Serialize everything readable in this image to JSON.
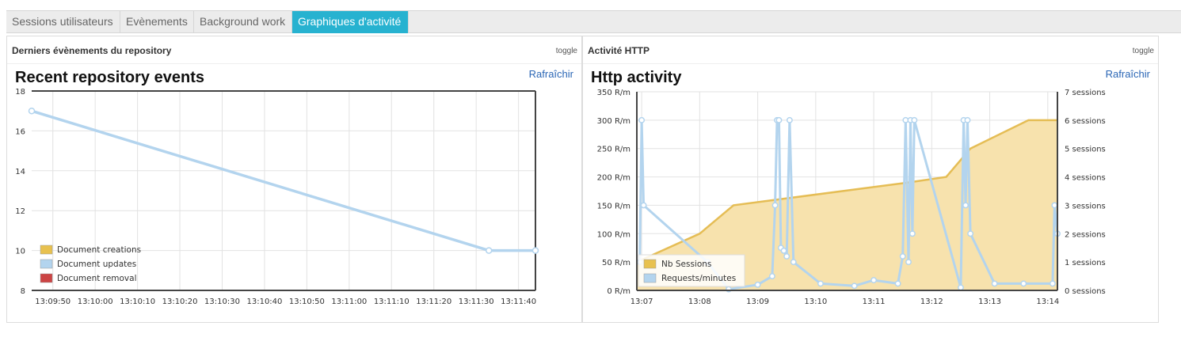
{
  "tabs": [
    {
      "label": "Sessions utilisateurs",
      "active": false
    },
    {
      "label": "Evènements",
      "active": false
    },
    {
      "label": "Background work",
      "active": false
    },
    {
      "label": "Graphiques d'activité",
      "active": true
    }
  ],
  "panels": {
    "left": {
      "title": "Derniers évènements du repository",
      "toggle": "toggle",
      "refresh": "Rafraîchir"
    },
    "right": {
      "title": "Activité HTTP",
      "toggle": "toggle",
      "refresh": "Rafraîchir"
    }
  },
  "colors": {
    "creations": "#e8c14f",
    "updates": "#b3d4ee",
    "removal": "#cc4444",
    "sessions_fill": "#f7e2ad",
    "sessions_line": "#e5bd55",
    "requests": "#b3d4ee",
    "tab_active": "#27b2d0",
    "link": "#2a66b5"
  },
  "chart_data": [
    {
      "type": "line",
      "title": "Recent repository events",
      "x_ticks": [
        "13:09:50",
        "13:10:00",
        "13:10:10",
        "13:10:20",
        "13:10:30",
        "13:10:40",
        "13:10:50",
        "13:11:00",
        "13:11:10",
        "13:11:20",
        "13:11:30",
        "13:11:40"
      ],
      "y_ticks": [
        "8",
        "10",
        "12",
        "14",
        "16",
        "18"
      ],
      "ylim": [
        8,
        18
      ],
      "xlim": [
        "13:09:45",
        "13:11:44"
      ],
      "grid": true,
      "legend": "bottom-left",
      "series": [
        {
          "name": "Document creations",
          "points": []
        },
        {
          "name": "Document updates",
          "points": [
            {
              "x": "13:09:45",
              "y": 17
            },
            {
              "x": "13:11:33",
              "y": 10
            },
            {
              "x": "13:11:44",
              "y": 10
            }
          ]
        },
        {
          "name": "Document removal",
          "points": []
        }
      ]
    },
    {
      "type": "area",
      "title": "Http activity",
      "x_ticks": [
        "13:07",
        "13:08",
        "13:09",
        "13:10",
        "13:11",
        "13:12",
        "13:13",
        "13:14"
      ],
      "xlim": [
        "13:06:55",
        "13:14:10"
      ],
      "y_left_ticks": [
        "0 R/m",
        "50 R/m",
        "100 R/m",
        "150 R/m",
        "200 R/m",
        "250 R/m",
        "300 R/m",
        "350 R/m"
      ],
      "y_left_lim": [
        0,
        350
      ],
      "y_right_ticks": [
        "0 sessions",
        "1 sessions",
        "2 sessions",
        "3 sessions",
        "4 sessions",
        "5 sessions",
        "6 sessions",
        "7 sessions"
      ],
      "y_right_lim": [
        0,
        7
      ],
      "grid": true,
      "legend": "bottom-left",
      "series": [
        {
          "name": "Nb Sessions",
          "axis": "right",
          "points": [
            {
              "x": "13:06:55",
              "y": 1
            },
            {
              "x": "13:08:00",
              "y": 2
            },
            {
              "x": "13:08:35",
              "y": 3
            },
            {
              "x": "13:11:35",
              "y": 3.8
            },
            {
              "x": "13:12:15",
              "y": 4
            },
            {
              "x": "13:12:40",
              "y": 5
            },
            {
              "x": "13:13:40",
              "y": 6
            },
            {
              "x": "13:14:10",
              "y": 6
            }
          ]
        },
        {
          "name": "Requests/minutes",
          "axis": "left",
          "points": [
            {
              "x": "13:06:58",
              "y": 50
            },
            {
              "x": "13:07:00",
              "y": 300
            },
            {
              "x": "13:07:02",
              "y": 150
            },
            {
              "x": "13:08:08",
              "y": 50
            },
            {
              "x": "13:08:30",
              "y": 2
            },
            {
              "x": "13:09:00",
              "y": 10
            },
            {
              "x": "13:09:15",
              "y": 25
            },
            {
              "x": "13:09:18",
              "y": 150
            },
            {
              "x": "13:09:20",
              "y": 300
            },
            {
              "x": "13:09:22",
              "y": 300
            },
            {
              "x": "13:09:24",
              "y": 75
            },
            {
              "x": "13:09:27",
              "y": 70
            },
            {
              "x": "13:09:30",
              "y": 60
            },
            {
              "x": "13:09:33",
              "y": 300
            },
            {
              "x": "13:09:37",
              "y": 50
            },
            {
              "x": "13:10:05",
              "y": 12
            },
            {
              "x": "13:10:40",
              "y": 8
            },
            {
              "x": "13:11:00",
              "y": 18
            },
            {
              "x": "13:11:25",
              "y": 12
            },
            {
              "x": "13:11:30",
              "y": 60
            },
            {
              "x": "13:11:33",
              "y": 300
            },
            {
              "x": "13:11:36",
              "y": 50
            },
            {
              "x": "13:11:38",
              "y": 300
            },
            {
              "x": "13:11:40",
              "y": 100
            },
            {
              "x": "13:11:42",
              "y": 300
            },
            {
              "x": "13:12:30",
              "y": 5
            },
            {
              "x": "13:12:33",
              "y": 300
            },
            {
              "x": "13:12:35",
              "y": 150
            },
            {
              "x": "13:12:37",
              "y": 300
            },
            {
              "x": "13:12:40",
              "y": 100
            },
            {
              "x": "13:13:05",
              "y": 12
            },
            {
              "x": "13:13:35",
              "y": 12
            },
            {
              "x": "13:14:05",
              "y": 12
            },
            {
              "x": "13:14:07",
              "y": 150
            },
            {
              "x": "13:14:10",
              "y": 100
            }
          ]
        }
      ]
    }
  ]
}
